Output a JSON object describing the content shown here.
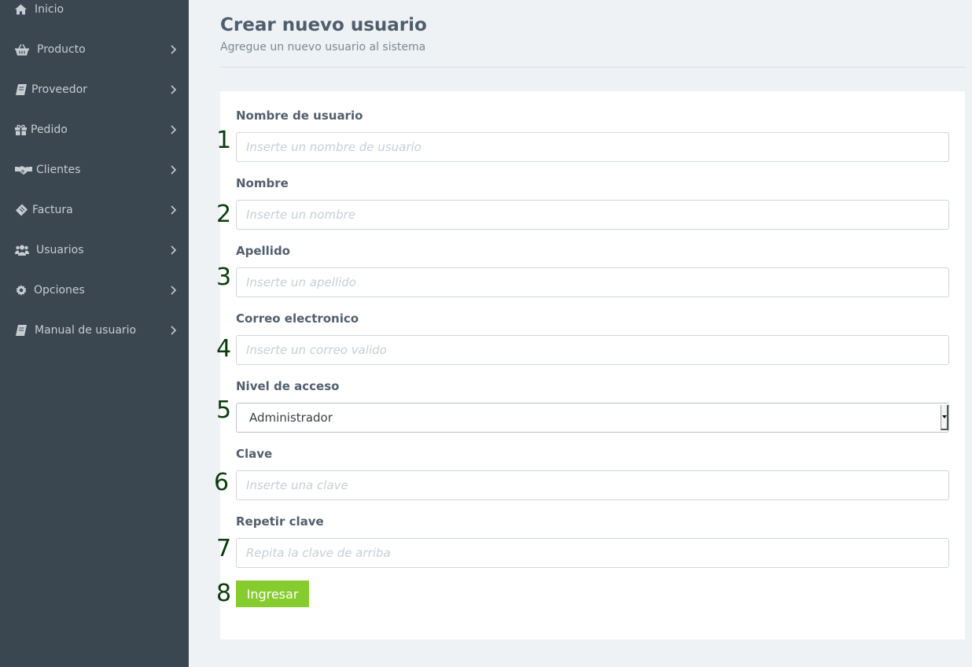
{
  "sidebar": {
    "items": [
      {
        "label": "Inicio",
        "icon": "home-icon"
      },
      {
        "label": "Producto",
        "icon": "basket-icon"
      },
      {
        "label": "Proveedor",
        "icon": "book-icon"
      },
      {
        "label": "Pedido",
        "icon": "gift-icon"
      },
      {
        "label": "Clientes",
        "icon": "handshake-icon"
      },
      {
        "label": "Factura",
        "icon": "ticket-icon"
      },
      {
        "label": "Usuarios",
        "icon": "users-icon"
      },
      {
        "label": "Opciones",
        "icon": "gear-icon"
      },
      {
        "label": "Manual de usuario",
        "icon": "book-icon"
      }
    ]
  },
  "page": {
    "title": "Crear nuevo usuario",
    "subtitle": "Agregue un nuevo usuario al sistema"
  },
  "form": {
    "fields": [
      {
        "label": "Nombre de usuario",
        "placeholder": "Inserte un nombre de usuario",
        "value": ""
      },
      {
        "label": "Nombre",
        "placeholder": "Inserte un nombre",
        "value": ""
      },
      {
        "label": "Apellido",
        "placeholder": "Inserte un apellido",
        "value": ""
      },
      {
        "label": "Correo electronico",
        "placeholder": "Inserte un correo valido",
        "value": ""
      },
      {
        "label": "Nivel de acceso",
        "selected": "Administrador"
      },
      {
        "label": "Clave",
        "placeholder": "Inserte una clave",
        "value": ""
      },
      {
        "label": "Repetir clave",
        "placeholder": "Repita la clave de arriba",
        "value": ""
      }
    ],
    "submit_label": "Ingresar"
  },
  "markers": [
    "1",
    "2",
    "3",
    "4",
    "5",
    "6",
    "7",
    "8"
  ],
  "colors": {
    "sidebar_bg": "#3a4650",
    "page_bg": "#eef2f5",
    "submit_bg": "#86cc2f",
    "marker": "#0b3d0b"
  }
}
